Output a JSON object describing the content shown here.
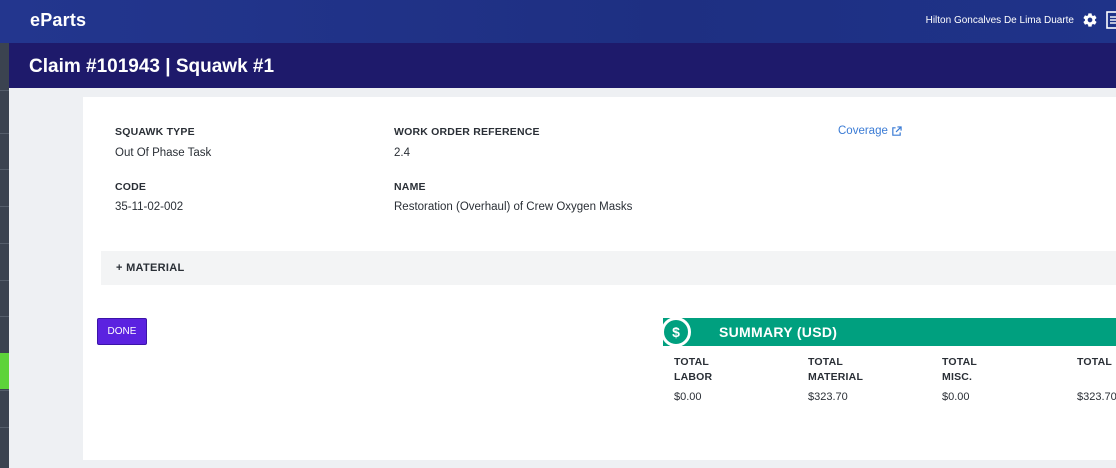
{
  "header": {
    "logo": "eParts",
    "user_name": "Hilton Goncalves De Lima Duarte"
  },
  "page": {
    "title": "Claim #101943 | Squawk #1"
  },
  "details": {
    "squawk_type_label": "SQUAWK TYPE",
    "squawk_type_value": "Out Of Phase Task",
    "work_order_label": "WORK ORDER REFERENCE",
    "work_order_value": "2.4",
    "coverage_link": "Coverage",
    "code_label": "CODE",
    "code_value": "35-11-02-002",
    "name_label": "NAME",
    "name_value": "Restoration (Overhaul) of Crew Oxygen Masks"
  },
  "material": {
    "label": "+ MATERIAL"
  },
  "actions": {
    "done_label": "DONE"
  },
  "summary": {
    "title": "SUMMARY (USD)",
    "icon_symbol": "$",
    "columns": [
      {
        "label_line1": "TOTAL",
        "label_line2": "LABOR",
        "value": "$0.00"
      },
      {
        "label_line1": "TOTAL",
        "label_line2": "MATERIAL",
        "value": "$323.70"
      },
      {
        "label_line1": "TOTAL",
        "label_line2": "MISC.",
        "value": "$0.00"
      },
      {
        "label_line1": "TOTAL",
        "label_line2": "",
        "value": "$323.70"
      }
    ]
  },
  "colors": {
    "topbar": "#23368e",
    "titlebar": "#1e1a6b",
    "accent_green": "#00a07f",
    "done_button": "#5b22e0",
    "link": "#3a7bd5"
  }
}
